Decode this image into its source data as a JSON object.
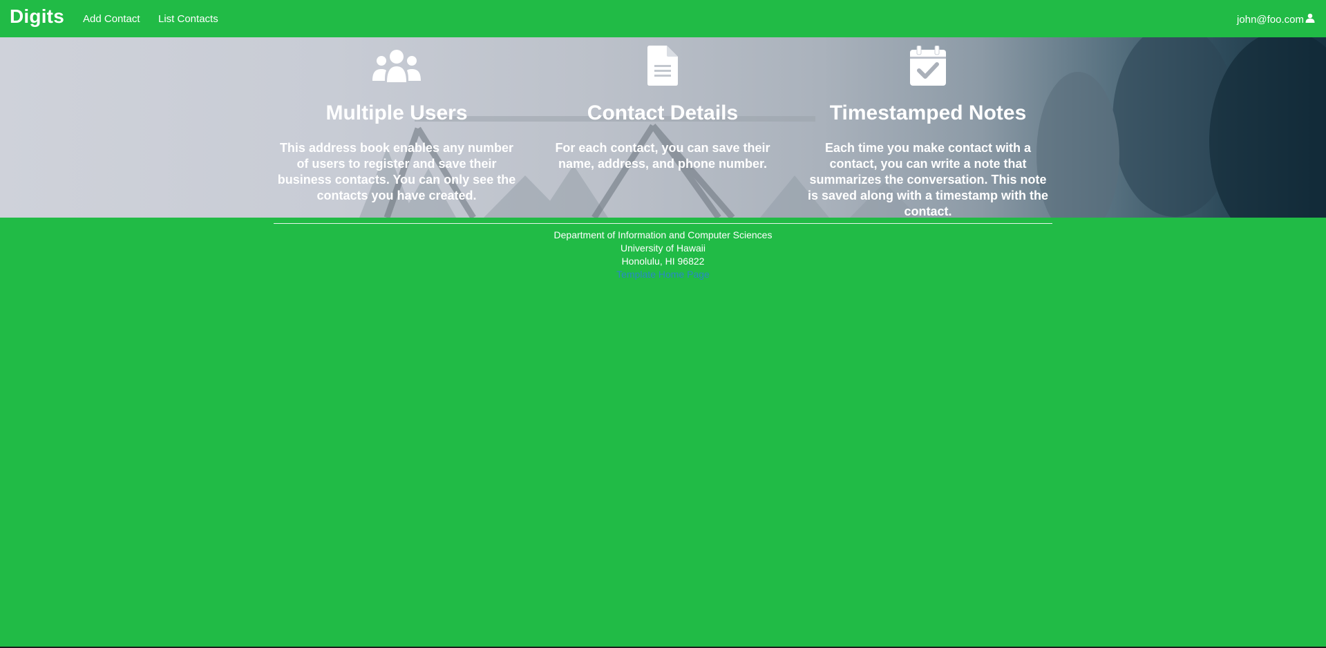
{
  "navbar": {
    "brand": "Digits",
    "links": [
      {
        "label": "Add Contact"
      },
      {
        "label": "List Contacts"
      }
    ],
    "user": {
      "email": "john@foo.com",
      "icon": "user-icon"
    }
  },
  "features": [
    {
      "icon": "users-icon",
      "title": "Multiple Users",
      "text": "This address book enables any number of users to register and save their business contacts. You can only see the contacts you have created."
    },
    {
      "icon": "file-icon",
      "title": "Contact Details",
      "text": "For each contact, you can save their name, address, and phone number."
    },
    {
      "icon": "calendar-check-icon",
      "title": "Timestamped Notes",
      "text": "Each time you make contact with a contact, you can write a note that summarizes the conversation. This note is saved along with a timestamp with the contact."
    }
  ],
  "footer": {
    "line1": "Department of Information and Computer Sciences",
    "line2": "University of Hawaii",
    "line3": "Honolulu, HI 96822",
    "link": "Template Home Page"
  },
  "colors": {
    "accent": "#21bb46",
    "link": "#2a88c4"
  }
}
